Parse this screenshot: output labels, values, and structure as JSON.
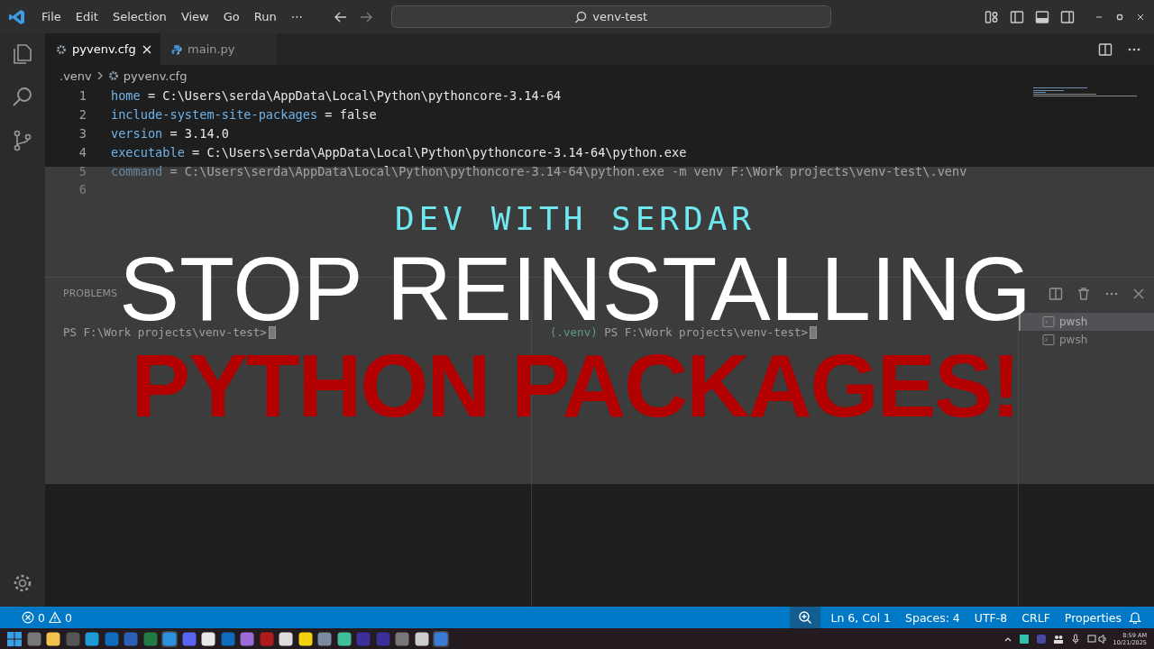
{
  "menu": [
    "File",
    "Edit",
    "Selection",
    "View",
    "Go",
    "Run",
    "⋯"
  ],
  "search": {
    "value": "venv-test"
  },
  "tabs": [
    {
      "label": "pyvenv.cfg",
      "selected": true,
      "kind": "config"
    },
    {
      "label": "main.py",
      "selected": false,
      "kind": "python"
    }
  ],
  "breadcrumb": [
    ".venv",
    "pyvenv.cfg"
  ],
  "code": [
    {
      "number": "1",
      "key": "home",
      "value": " = C:\\Users\\serda\\AppData\\Local\\Python\\pythoncore-3.14-64"
    },
    {
      "number": "2",
      "key": "include-system-site-packages",
      "value": " = false"
    },
    {
      "number": "3",
      "key": "version",
      "value": " = 3.14.0"
    },
    {
      "number": "4",
      "key": "executable",
      "value": " = C:\\Users\\serda\\AppData\\Local\\Python\\pythoncore-3.14-64\\python.exe"
    },
    {
      "number": "5",
      "key": "command",
      "value": " = C:\\Users\\serda\\AppData\\Local\\Python\\pythoncore-3.14-64\\python.exe -m venv F:\\Work projects\\venv-test\\.venv"
    },
    {
      "number": "6"
    }
  ],
  "panel": {
    "tabs": [
      "PROBLEMS"
    ],
    "terminals": [
      {
        "prompt": "PS F:\\Work projects\\venv-test>"
      },
      {
        "env": "(.venv)",
        "prompt": " PS F:\\Work projects\\venv-test>"
      }
    ],
    "terminal_list": [
      {
        "label": "pwsh",
        "selected": true
      },
      {
        "label": "pwsh",
        "selected": false
      }
    ]
  },
  "status_bar": {
    "errors": "0",
    "warnings": "0",
    "items": [
      "Ln 6, Col 1",
      "Spaces: 4",
      "UTF-8",
      "CRLF",
      "Properties"
    ]
  },
  "overlay": {
    "channel": "DEV WITH SERDAR",
    "title": "STOP REINSTALLING",
    "subtitle": "PYTHON PACKAGES!"
  },
  "clock": {
    "time": "8:59 AM",
    "date": "10/21/2025"
  }
}
